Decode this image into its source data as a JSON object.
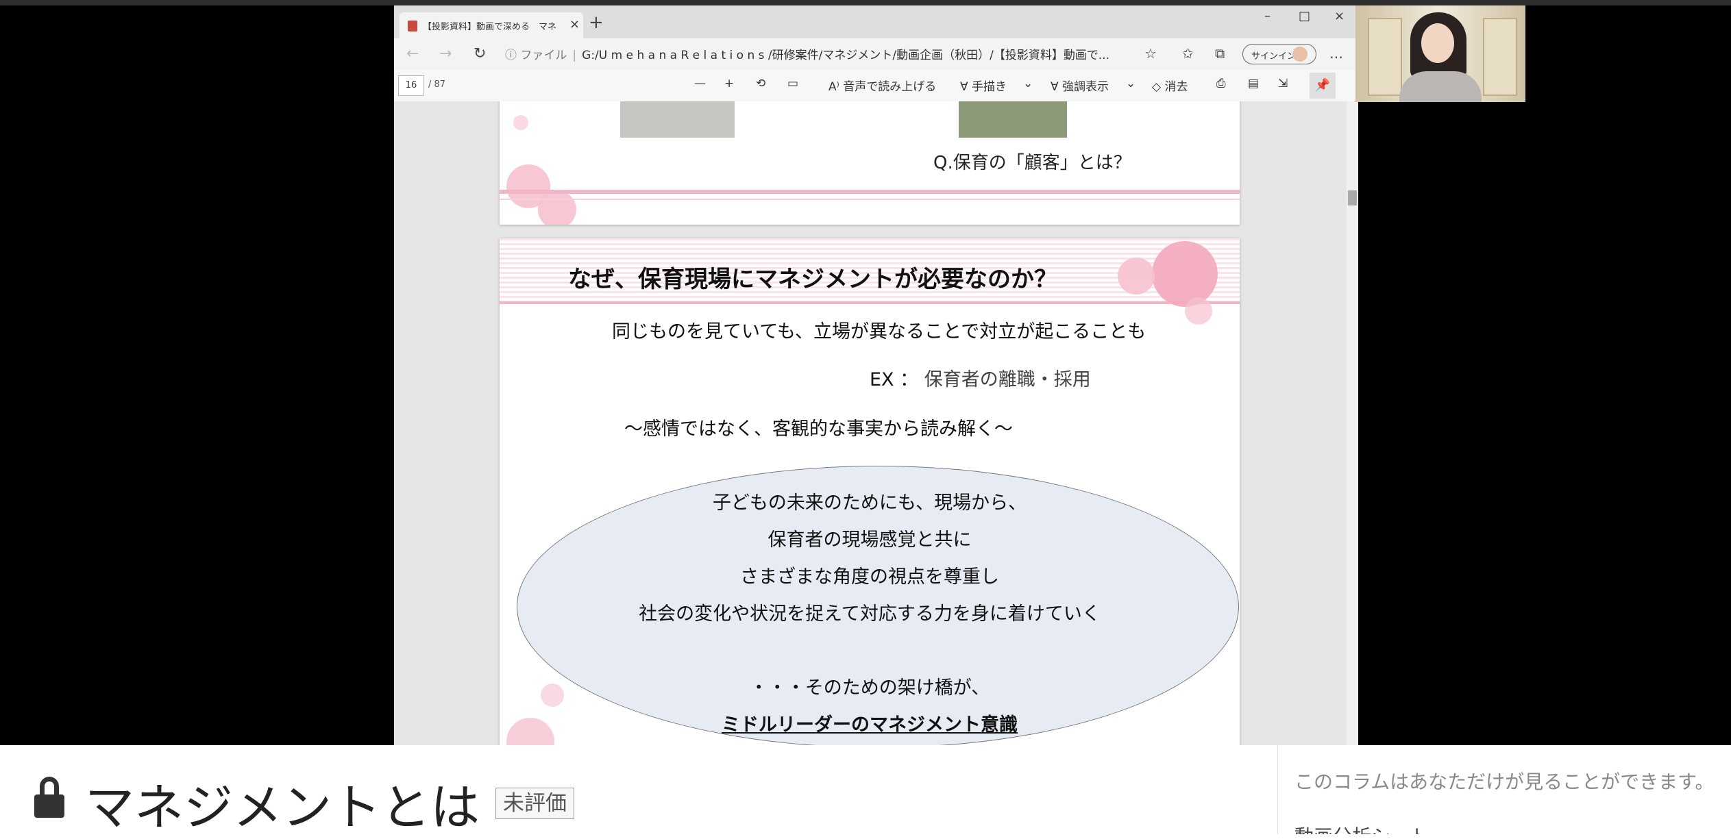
{
  "browser": {
    "tab_title": "【投影資料】動画で深める　マネジメ",
    "tab_close": "×",
    "new_tab": "+",
    "window_min": "–",
    "window_max": "□",
    "window_close": "×",
    "nav_back": "←",
    "nav_forward": "→",
    "nav_refresh": "↻",
    "url_prefix": "ⓘ ファイル",
    "url_path": "G:/U m e h a n a R e l a t i o n s /研修案件/マネジメント/動画企画（秋田）/【投影資料】動画で...",
    "favorite_icon": "☆",
    "favorites_icon": "✩",
    "collections_icon": "⧉",
    "signin_label": "サインイン",
    "more_icon": "…"
  },
  "pdf_toolbar": {
    "page_current": "16",
    "page_total": "/ 87",
    "zoom_out": "—",
    "zoom_in": "+",
    "rotate": "⟲",
    "fit": "▭",
    "read_aloud": "A⁾ 音声で読み上げる",
    "draw": "∀ 手描き",
    "draw_caret": "⌄",
    "highlight": "∀ 強調表示",
    "highlight_caret": "⌄",
    "erase": "◇ 消去",
    "print_icon": "⎙",
    "save_icon": "▤",
    "saveas_icon": "⇲",
    "pin_icon": "📌"
  },
  "slide_prev": {
    "question": "Q.保育の「顧客」とは？"
  },
  "slide": {
    "title": "なぜ、保育現場にマネジメントが必要なのか？",
    "line1": "同じものを見ていても、立場が異なることで対立が起こることも",
    "ex_label": "EX ： ",
    "ex_value": "保育者の離職・採用",
    "subtitle": "～感情ではなく、客観的な事実から読み解く～",
    "ellipse_lines": [
      "子どもの未来のためにも、現場から、",
      "保育者の現場感覚と共に",
      "さまざまな角度の視点を尊重し",
      "社会の変化や状況を捉えて対応する力を身に着けていく",
      "・・・そのための架け橋が、",
      "ミドルリーダーのマネジメント意識"
    ]
  },
  "page": {
    "title": "マネジメントとは",
    "badge": "未評価"
  },
  "sidebar": {
    "note": "このコラムはあなただけが見ることができます。",
    "next": "動画分析シート"
  }
}
